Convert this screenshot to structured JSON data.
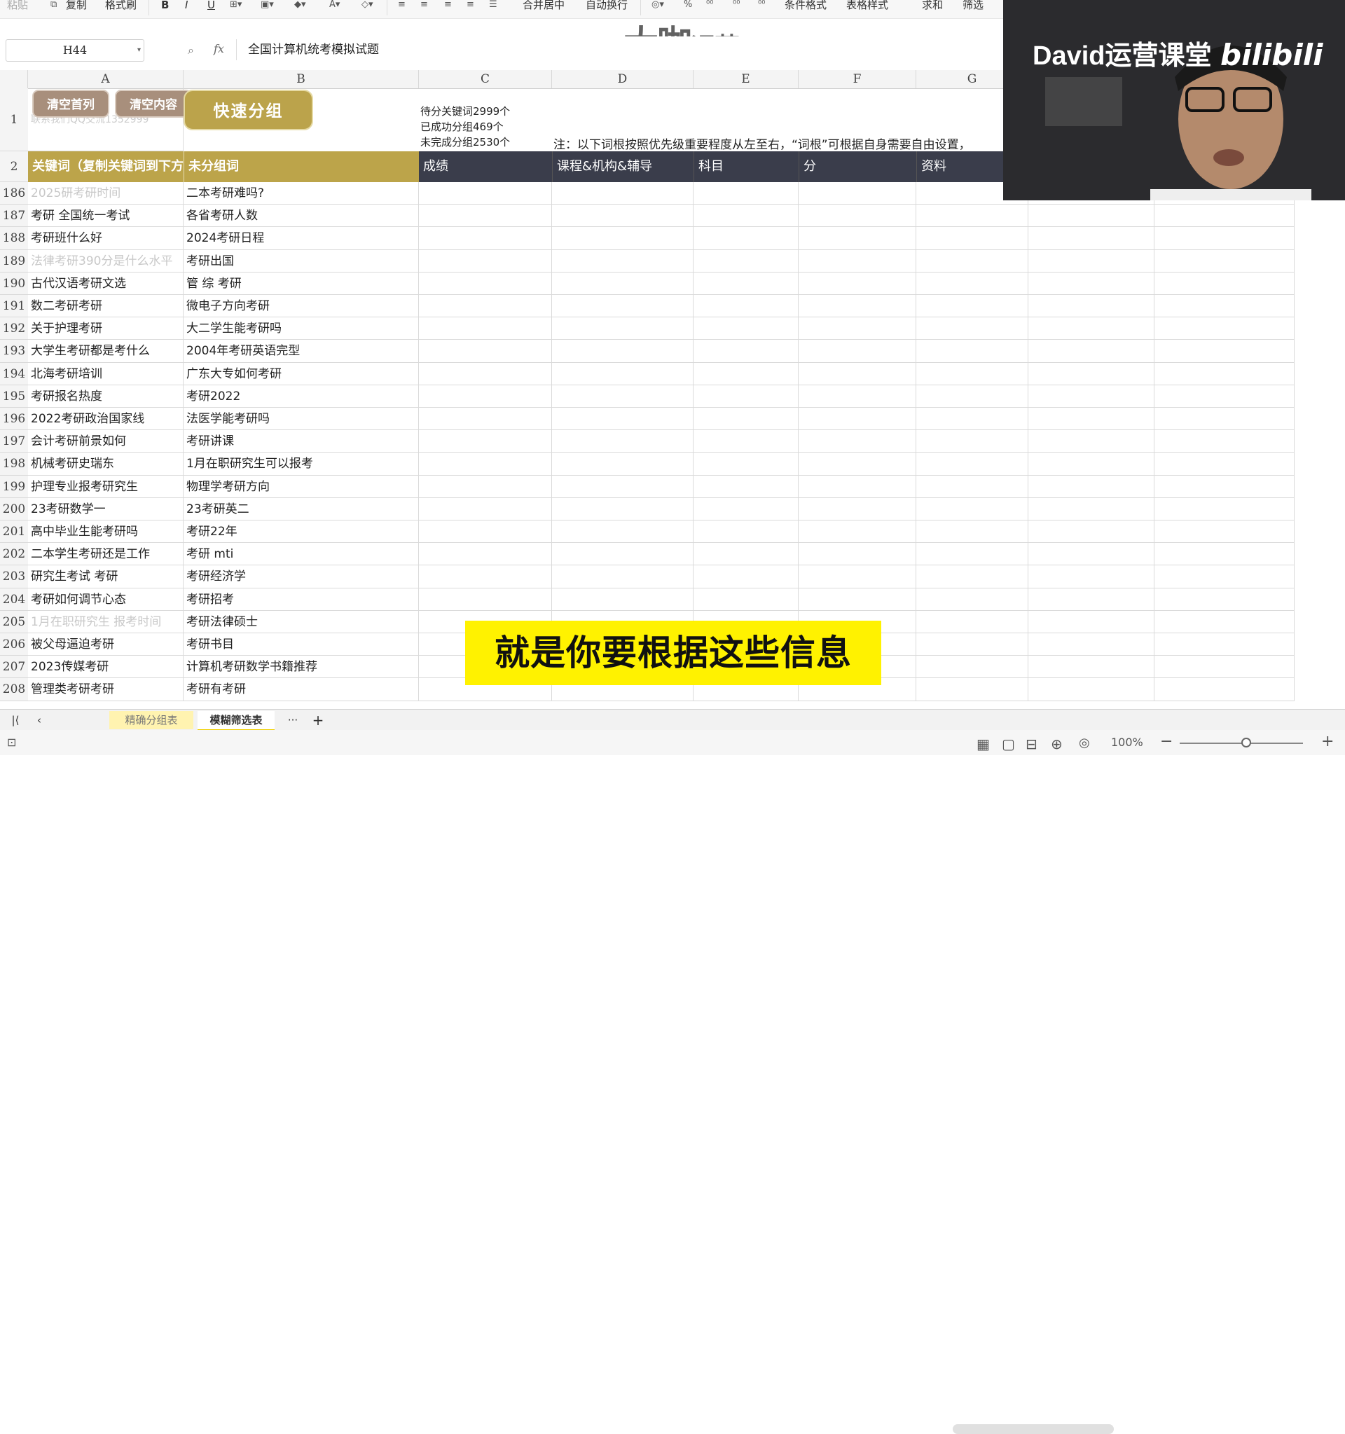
{
  "ribbon": {
    "paste": "粘贴",
    "copy": "复制",
    "format_painter": "格式刷",
    "bold": "B",
    "italic": "I",
    "underline": "U",
    "merge_center": "合并居中",
    "wrap_text": "自动换行",
    "conditional_format": "条件格式",
    "table_style": "表格样式",
    "sum": "求和",
    "filter": "筛选"
  },
  "formula_bar": {
    "name_box": "H44",
    "fx": "fx",
    "content": "全国计算机统考模拟试题"
  },
  "columns": [
    "A",
    "B",
    "C",
    "D",
    "E",
    "F",
    "G"
  ],
  "row1": {
    "clear_first_col": "清空首列",
    "clear_content": "清空内容",
    "quick_group": "快速分组",
    "a1_text": "联系我们QQ交流1352999",
    "stat_pending": "待分关键词2999个",
    "stat_done": "已成功分组469个",
    "stat_undone": "未完成分组2530个",
    "note": "注：以下词根按照优先级重要程度从左至右，“词根”可根据自身需要自由设置，"
  },
  "row2": {
    "a": "关键词（复制关键词到下方",
    "b": "未分组词",
    "c": "成绩",
    "d": "课程&机构&辅导",
    "e": "科目",
    "f": "分",
    "g": "资料"
  },
  "rows": [
    {
      "num": "186",
      "a": "2025研考研时间",
      "b": "二本考研难吗?",
      "a_faded": true
    },
    {
      "num": "187",
      "a": "考研 全国统一考试",
      "b": "各省考研人数"
    },
    {
      "num": "188",
      "a": "考研班什么好",
      "b": "2024考研日程"
    },
    {
      "num": "189",
      "a": "法律考研390分是什么水平",
      "b": "考研出国",
      "a_faded": true
    },
    {
      "num": "190",
      "a": "古代汉语考研文选",
      "b": "管 综 考研"
    },
    {
      "num": "191",
      "a": "数二考研考研",
      "b": "微电子方向考研"
    },
    {
      "num": "192",
      "a": "关于护理考研",
      "b": "大二学生能考研吗"
    },
    {
      "num": "193",
      "a": "大学生考研都是考什么",
      "b": "2004年考研英语完型"
    },
    {
      "num": "194",
      "a": "北海考研培训",
      "b": "广东大专如何考研"
    },
    {
      "num": "195",
      "a": "考研报名热度",
      "b": "考研2022"
    },
    {
      "num": "196",
      "a": "2022考研政治国家线",
      "b": "法医学能考研吗"
    },
    {
      "num": "197",
      "a": "会计考研前景如何",
      "b": "考研讲课"
    },
    {
      "num": "198",
      "a": "机械考研史瑞东",
      "b": "1月在职研究生可以报考"
    },
    {
      "num": "199",
      "a": "护理专业报考研究生",
      "b": "物理学考研方向"
    },
    {
      "num": "200",
      "a": "23考研数学一",
      "b": "23考研英二"
    },
    {
      "num": "201",
      "a": "高中毕业生能考研吗",
      "b": "考研22年"
    },
    {
      "num": "202",
      "a": "二本学生考研还是工作",
      "b": "考研 mti"
    },
    {
      "num": "203",
      "a": "研究生考试 考研",
      "b": "考研经济学"
    },
    {
      "num": "204",
      "a": "考研如何调节心态",
      "b": "考研招考"
    },
    {
      "num": "205",
      "a": "1月在职研究生 报考时间",
      "b": "考研法律硕士",
      "a_faded": true
    },
    {
      "num": "206",
      "a": "被父母逼迫考研",
      "b": "考研书目"
    },
    {
      "num": "207",
      "a": "2023传媒考研",
      "b": "计算机考研数学书籍推荐"
    },
    {
      "num": "208",
      "a": "管理类考研考研",
      "b": "考研有考研"
    }
  ],
  "subtitle": "就是你要根据这些信息",
  "watermark": {
    "big": "大咖",
    "small": "运营"
  },
  "webcam": {
    "title": "David运营课堂",
    "brand": "bilibili"
  },
  "sheet_tabs": {
    "tab1": "精确分组表",
    "tab2": "模糊筛选表",
    "more": "···",
    "add": "+"
  },
  "status": {
    "zoom": "100%"
  },
  "colors": {
    "header_gold": "#bca44a",
    "header_dark": "#3a3d4b",
    "subtitle_bg": "#fff200"
  }
}
